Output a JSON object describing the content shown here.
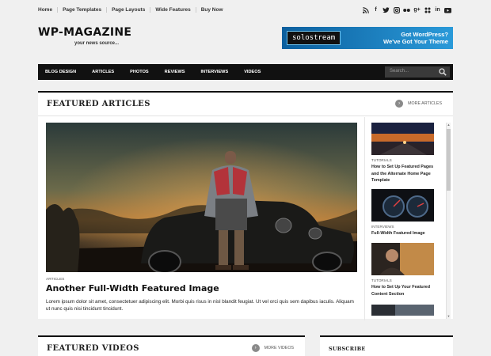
{
  "topnav": [
    "Home",
    "Page Templates",
    "Page Layouts",
    "Wide Features",
    "Buy Now"
  ],
  "social_icons": [
    "rss-icon",
    "facebook-icon",
    "twitter-icon",
    "instagram-icon",
    "flickr-icon",
    "googleplus-icon",
    "delicious-icon",
    "linkedin-icon",
    "youtube-icon"
  ],
  "site": {
    "title": "WP-MAGAZINE",
    "tagline": "your news source..."
  },
  "banner": {
    "brand": "solostream",
    "line1": "Got WordPress?",
    "line2": "We've Got Your Theme"
  },
  "mainnav": [
    "BLOG DESIGN",
    "ARTICLES",
    "PHOTOS",
    "REVIEWS",
    "INTERVIEWS",
    "VIDEOS"
  ],
  "search": {
    "placeholder": "Search..."
  },
  "featured": {
    "title": "FEATURED ARTICLES",
    "more": "MORE ARTICLES",
    "hero": {
      "category": "ARTICLES",
      "title": "Another Full-Width Featured Image",
      "excerpt": "Lorem ipsum dolor sit amet, consectetuer adipiscing elit. Morbi quis risus in nisl blandit feugiat. Ut vel orci quis sem dapibus iaculis. Aliquam ut nunc quis nisi tincidunt tincidunt."
    },
    "side": [
      {
        "category": "TUTORIALS",
        "title": "How to Set Up Featured Pages and the Alternate Home Page Template"
      },
      {
        "category": "INTERVIEWS",
        "title": "Full-Width Featured Image"
      },
      {
        "category": "TUTORIALS",
        "title": "How to Set Up Your Featured Content Section"
      }
    ]
  },
  "videos": {
    "title": "FEATURED VIDEOS",
    "more": "MORE VIDEOS"
  },
  "subscribe": {
    "title": "SUBSCRIBE"
  },
  "colors": {
    "accent": "#111111",
    "banner": "#1f86c9",
    "link": "#333333"
  }
}
